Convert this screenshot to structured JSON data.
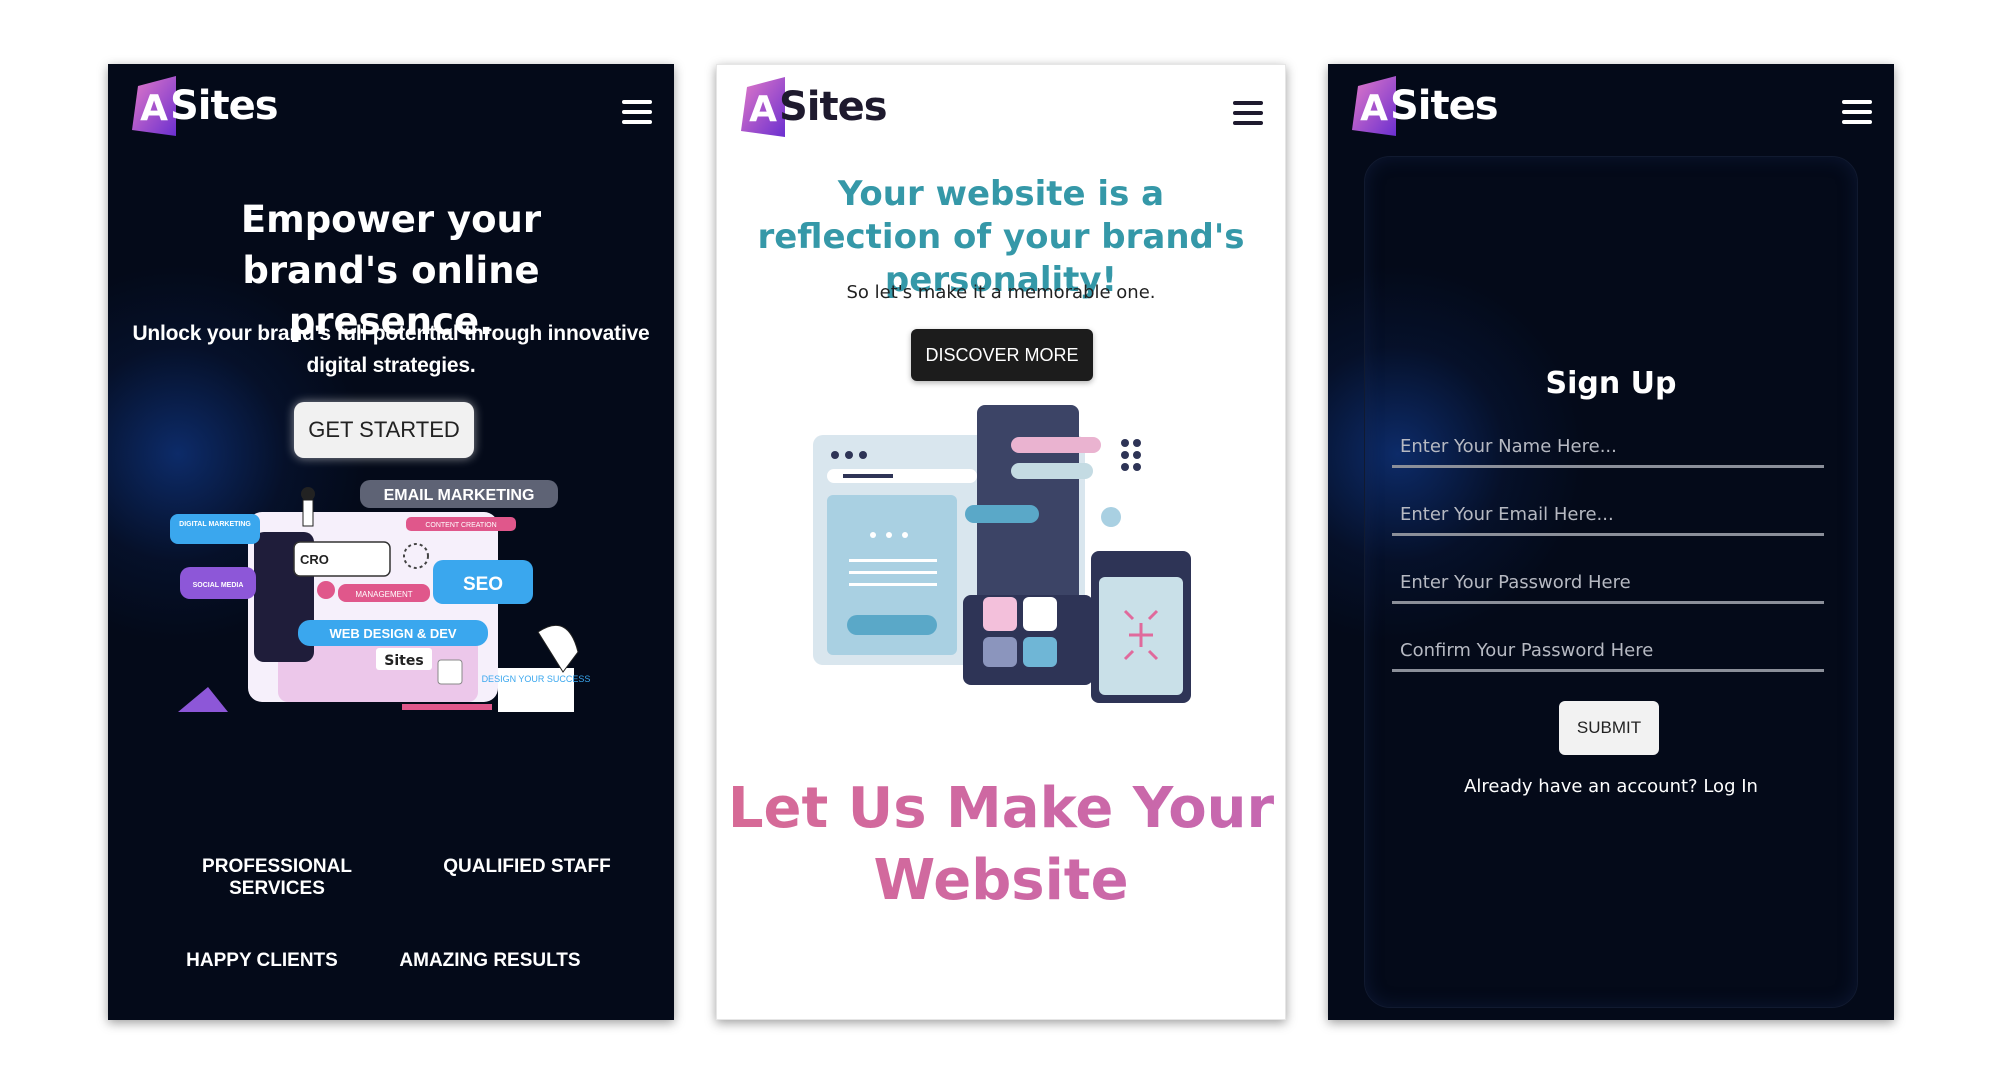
{
  "screens": {
    "signup_page": {
      "logo_text": "Sites",
      "title": "Sign Up",
      "fields": {
        "name_placeholder": "Enter Your Name Here...",
        "email_placeholder": "Enter Your Email Here...",
        "password_placeholder": "Enter Your Password Here",
        "confirm_placeholder": "Confirm Your Password Here"
      },
      "submit_label": "SUBMIT",
      "login_prompt": "Already have an account?",
      "login_link": "Log In"
    },
    "home_dark": {
      "logo_text": "Sites",
      "headline": "Empower your brand's online presence.",
      "subheadline": "Unlock your brand's full potential through innovative digital strategies.",
      "cta_label": "GET STARTED",
      "illustration_labels": {
        "email": "EMAIL MARKETING",
        "digital": "DIGITAL MARKETING",
        "content": "CONTENT CREATION",
        "cro": "CRO",
        "seo": "SEO",
        "social": "SOCIAL MEDIA",
        "management": "MANAGEMENT",
        "webdesign": "WEB DESIGN & DEV",
        "brand": "Sites",
        "design": "DESIGN YOUR SUCCESS"
      },
      "features": [
        "PROFESSIONAL SERVICES",
        "QUALIFIED STAFF",
        "HAPPY CLIENTS",
        "AMAZING RESULTS"
      ]
    },
    "home_light": {
      "logo_text": "Sites",
      "headline": "Your website is a reflection of your brand's personality!",
      "subheadline": "So let's make it a memorable one.",
      "cta_label": "DISCOVER MORE",
      "big_title": "Let Us Make Your Website"
    }
  },
  "colors": {
    "dark_bg": "#040a19",
    "accent_teal": "#3598a8",
    "accent_pink": "#d76a95",
    "logo_purple": "#7b35d6",
    "logo_pink": "#e078c6"
  },
  "icons": {
    "menu": "hamburger-menu-icon",
    "logo": "a-logo-icon"
  }
}
